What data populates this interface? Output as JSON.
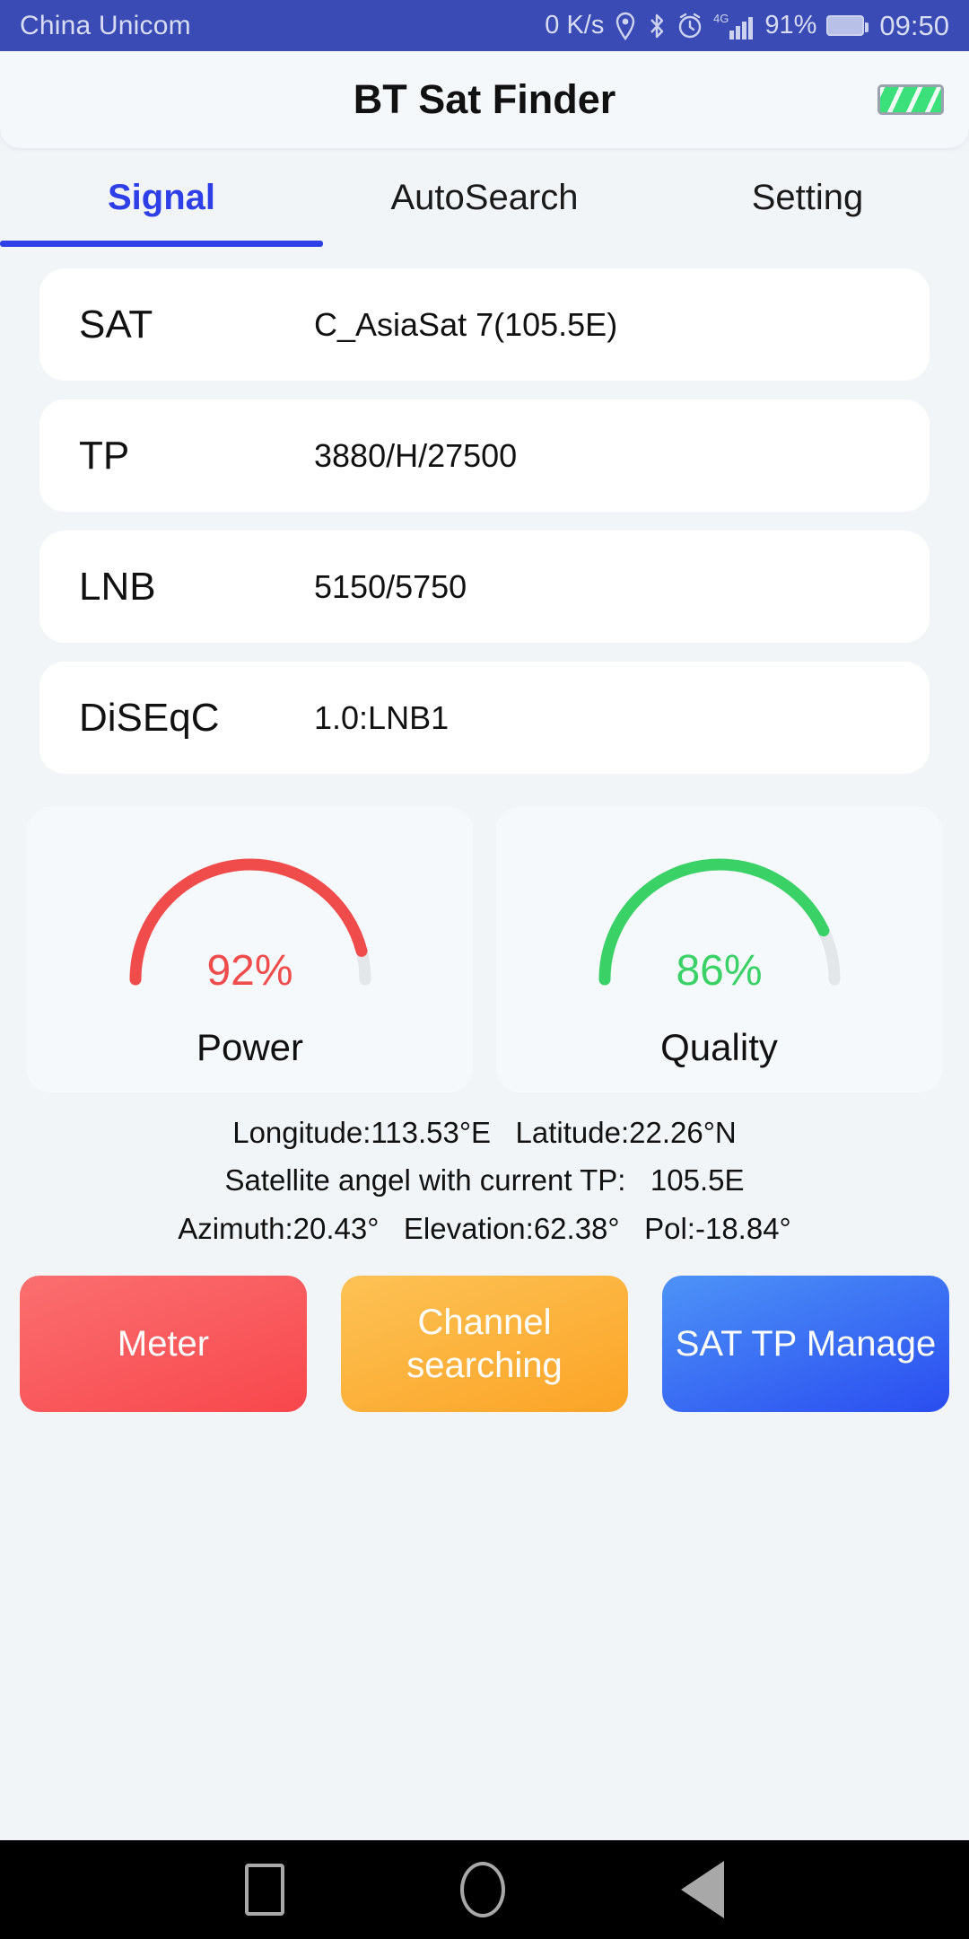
{
  "statusbar": {
    "carrier": "China Unicom",
    "netspeed": "0 K/s",
    "icons": [
      "location-pin-icon",
      "bluetooth-icon",
      "alarm-clock-icon",
      "4g-signal-icon"
    ],
    "network_type": "4G",
    "battery_percent": "91%",
    "clock": "09:50",
    "background_color": "#3a4bb5"
  },
  "header": {
    "title": "BT Sat Finder",
    "device_battery_icon": "battery-full-icon",
    "battery_color": "#3ce07a"
  },
  "tabs": [
    {
      "label": "Signal",
      "active": true
    },
    {
      "label": "AutoSearch",
      "active": false
    },
    {
      "label": "Setting",
      "active": false
    }
  ],
  "tab_accent_color": "#2f3fe8",
  "info_rows": [
    {
      "label": "SAT",
      "value": "C_AsiaSat 7(105.5E)"
    },
    {
      "label": "TP",
      "value": "3880/H/27500"
    },
    {
      "label": "LNB",
      "value": "5150/5750"
    },
    {
      "label": "DiSEqC",
      "value": "1.0:LNB1"
    }
  ],
  "gauges": [
    {
      "name": "Power",
      "value": "92%",
      "percent": 92,
      "color": "#f04c4c",
      "track_color": "#e4e7ea"
    },
    {
      "name": "Quality",
      "value": "86%",
      "percent": 86,
      "color": "#3ad266",
      "track_color": "#e4e7ea"
    }
  ],
  "coordinates": {
    "line1": "Longitude:113.53°E   Latitude:22.26°N",
    "line2": "Satellite angel with current TP:   105.5E",
    "line3": "Azimuth:20.43°   Elevation:62.38°   Pol:-18.84°"
  },
  "buttons": [
    {
      "label": "Meter",
      "color": "#f8474c"
    },
    {
      "label": "Channel searching",
      "color": "#fba426"
    },
    {
      "label": "SAT TP Manage",
      "color": "#2a4df0"
    }
  ],
  "navbar": {
    "recents": "square-recents-icon",
    "home": "circle-home-icon",
    "back": "triangle-back-icon"
  }
}
